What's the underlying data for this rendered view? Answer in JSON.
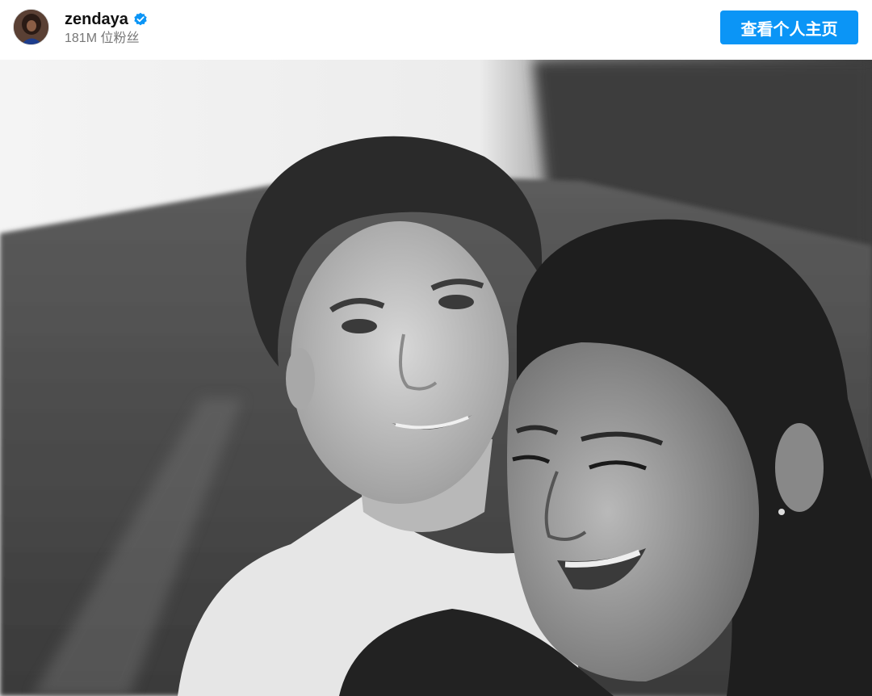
{
  "post_header": {
    "username": "zendaya",
    "followers": "181M 位粉丝",
    "view_profile_label": "查看个人主页",
    "accent_color": "#0b95f6",
    "verified_icon": "verified-badge-icon"
  },
  "photo": {
    "style": "black-and-white"
  }
}
